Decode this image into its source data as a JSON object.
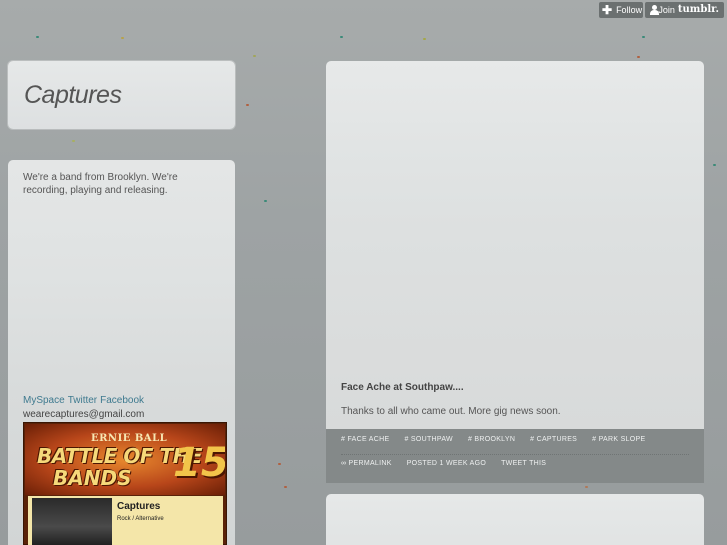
{
  "tumblr_controls": {
    "follow_label": "Follow",
    "join_label": "Join",
    "brand": "tumblr."
  },
  "blog": {
    "title": "Captures"
  },
  "sidebar": {
    "description": "We're a band from Brooklyn. We're recording, playing and releasing.",
    "social_links": [
      "MySpace",
      "Twitter",
      "Facebook"
    ],
    "email": "wearecaptures@gmail.com",
    "banner": {
      "brand": "ERNIE BALL",
      "line1": "BATTLE OF THE",
      "line2": "BANDS",
      "number": "15",
      "band_name": "Captures",
      "genre": "Rock / Alternative"
    }
  },
  "post": {
    "title": "Face Ache at Southpaw....",
    "body": "Thanks to all who came out. More gig news soon.",
    "tags": [
      "# FACE ACHE",
      "# SOUTHPAW",
      "# BROOKLYN",
      "# CAPTURES",
      "# PARK SLOPE"
    ],
    "permalink": "∞ PERMALINK",
    "posted": "POSTED 1 WEEK AGO",
    "tweet": "TWEET THIS"
  },
  "colors": {
    "background": "#9ea3a4",
    "panel": "#e1e4e4",
    "link": "#3f7a8f",
    "post_footer": "#848989"
  }
}
